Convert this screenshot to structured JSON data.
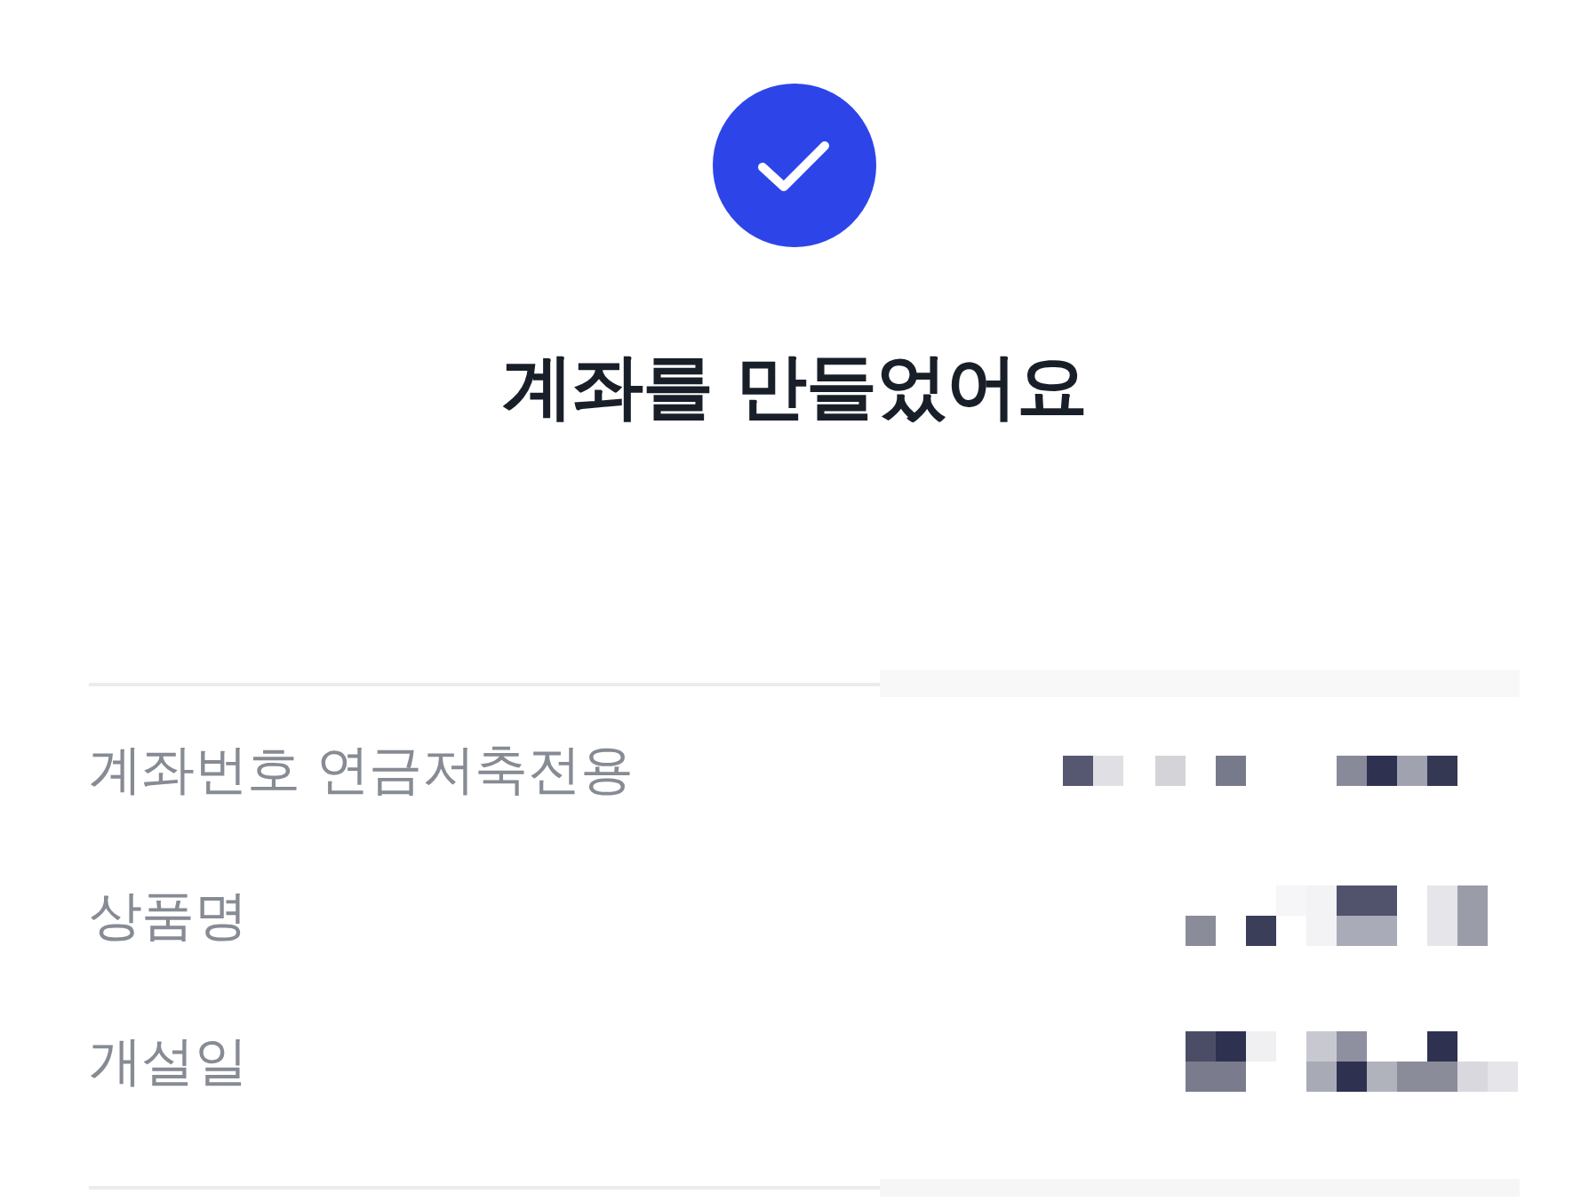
{
  "title": "계좌를 만들었어요",
  "details": [
    {
      "label": "계좌번호 연금저축전용",
      "redacted": true
    },
    {
      "label": "상품명",
      "redacted": true
    },
    {
      "label": "개설일",
      "redacted": true
    }
  ]
}
